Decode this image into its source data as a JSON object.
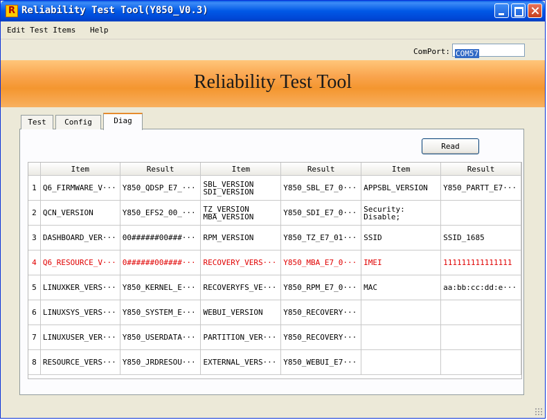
{
  "window": {
    "title": "Reliability Test Tool(Y850_V0.3)",
    "icon_letter": "R"
  },
  "menu": {
    "items": [
      "Edit Test Items",
      "Help"
    ]
  },
  "comport": {
    "label": "ComPort:",
    "value": "COM57"
  },
  "banner": {
    "title": "Reliability Test Tool"
  },
  "tabs": [
    {
      "label": "Test",
      "active": false
    },
    {
      "label": "Config",
      "active": false
    },
    {
      "label": "Diag",
      "active": true
    }
  ],
  "read_button": {
    "label": "Read"
  },
  "table": {
    "headers": [
      "Item",
      "Result",
      "Item",
      "Result",
      "Item",
      "Result"
    ],
    "rows": [
      {
        "num": "1",
        "cells": [
          "Q6_FIRMWARE_V···",
          "Y850_QDSP_E7_···",
          "SBL_VERSION\nSDI_VERSION",
          "Y850_SBL_E7_0···",
          "APPSBL_VERSION",
          "Y850_PARTT_E7···"
        ]
      },
      {
        "num": "2",
        "cells": [
          "QCN_VERSION",
          "Y850_EFS2_00_···",
          "TZ_VERSION\nMBA_VERSION",
          "Y850_SDI_E7_0···",
          "Security:\nDisable;",
          ""
        ]
      },
      {
        "num": "3",
        "cells": [
          "DASHBOARD_VER···",
          "00######00###···",
          "RPM_VERSION",
          "Y850_TZ_E7_01···",
          "SSID",
          "SSID_1685"
        ]
      },
      {
        "num": "4",
        "cells": [
          "Q6_RESOURCE_V···",
          "0######00####···",
          "RECOVERY_VERS···",
          "Y850_MBA_E7_0···",
          "IMEI",
          "111111111111111"
        ],
        "highlight": true
      },
      {
        "num": "5",
        "cells": [
          "LINUXKER_VERS···",
          "Y850_KERNEL_E···",
          "RECOVERYFS_VE···",
          "Y850_RPM_E7_0···",
          "MAC",
          "aa:bb:cc:dd:e···"
        ]
      },
      {
        "num": "6",
        "cells": [
          "LINUXSYS_VERS···",
          "Y850_SYSTEM_E···",
          "WEBUI_VERSION",
          "Y850_RECOVERY···",
          "",
          ""
        ]
      },
      {
        "num": "7",
        "cells": [
          "LINUXUSER_VER···",
          "Y850_USERDATA···",
          "PARTITION_VER···",
          "Y850_RECOVERY···",
          "",
          ""
        ]
      },
      {
        "num": "8",
        "cells": [
          "RESOURCE_VERS···",
          "Y850_JRDRESOU···",
          "EXTERNAL_VERS···",
          "Y850_WEBUI_E7···",
          "",
          ""
        ]
      }
    ]
  }
}
